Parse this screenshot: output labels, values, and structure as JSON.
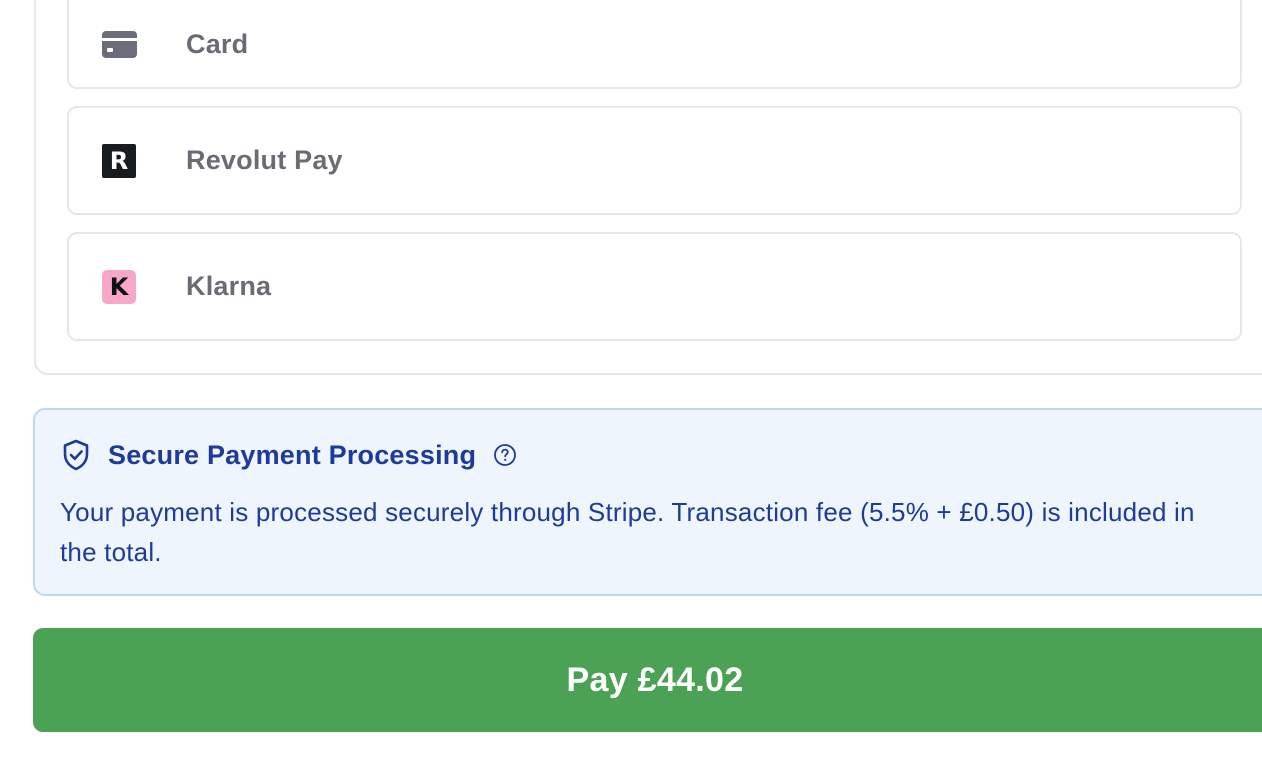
{
  "payment_methods": {
    "items": [
      {
        "label": "Card",
        "icon": "card-icon"
      },
      {
        "label": "Revolut Pay",
        "icon": "revolut-icon",
        "icon_glyph": "R"
      },
      {
        "label": "Klarna",
        "icon": "klarna-icon",
        "icon_glyph": "K"
      }
    ]
  },
  "secure_info": {
    "title": "Secure Payment Processing",
    "icon": "shield-check-icon",
    "help_icon": "question-circle-icon",
    "text": "Your payment is processed securely through Stripe. Transaction fee (5.5% + £0.50) is included in the total."
  },
  "pay_button": {
    "label": "Pay £44.02"
  },
  "colors": {
    "accent_green": "#4ca254",
    "info_blue": "#1e3a9a",
    "info_bg": "#eff5fd",
    "klarna_pink": "#f7a8c6",
    "revolut_black": "#191c1f"
  }
}
